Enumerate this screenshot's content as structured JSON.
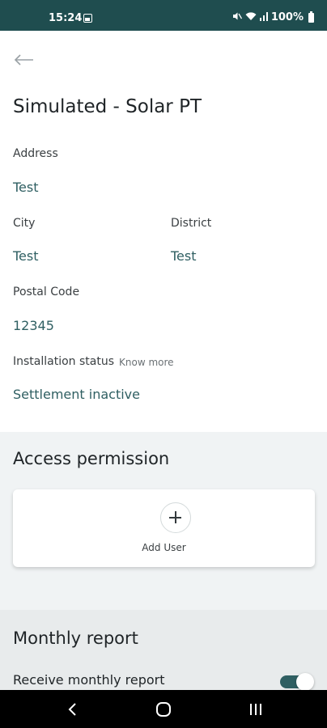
{
  "status_bar": {
    "time": "15:24",
    "battery": "100%",
    "icons": [
      "image-icon",
      "mute-icon",
      "wifi-icon",
      "signal-icon",
      "battery-icon"
    ]
  },
  "header": {
    "back_icon": "arrow-left-icon",
    "title": "Simulated - Solar PT"
  },
  "details": {
    "address_label": "Address",
    "address_value": "Test",
    "city_label": "City",
    "city_value": "Test",
    "district_label": "District",
    "district_value": "Test",
    "postal_label": "Postal Code",
    "postal_value": "12345",
    "installation_label": "Installation status",
    "know_more": "Know more",
    "installation_value": "Settlement inactive"
  },
  "access": {
    "title": "Access permission",
    "add_user_label": "Add User",
    "add_icon": "plus-icon"
  },
  "report": {
    "title": "Monthly report",
    "receive_label": "Receive monthly report",
    "receive_enabled": true
  },
  "nav": {
    "icons": [
      "back-nav-icon",
      "home-nav-icon",
      "recents-nav-icon"
    ]
  },
  "colors": {
    "status_bar": "#1f4d4f",
    "accent": "#2f5f62",
    "section_bg": "#f0f3f4"
  }
}
